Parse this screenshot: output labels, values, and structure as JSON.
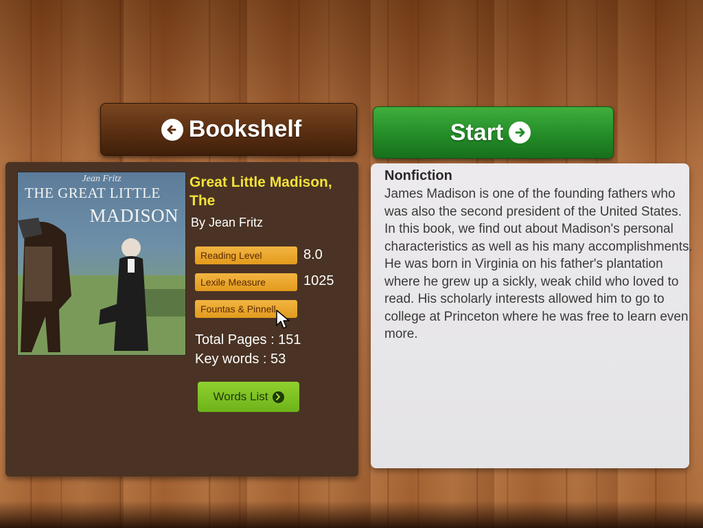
{
  "nav": {
    "bookshelf_label": "Bookshelf",
    "start_label": "Start"
  },
  "book": {
    "cover": {
      "author": "Jean Fritz",
      "title_line1": "THE GREAT LITTLE",
      "title_line2": "MADISON"
    },
    "title": "Great Little Madison, The",
    "author": "By Jean Fritz",
    "reading_level_label": "Reading Level",
    "reading_level_value": "8.0",
    "lexile_label": "Lexile Measure",
    "lexile_value": "1025",
    "fountas_label": "Fountas & Pinnell",
    "total_pages": "Total Pages : 151",
    "key_words": "Key words : 53",
    "words_list_label": "Words List"
  },
  "description": {
    "genre": "Nonfiction",
    "text": "James Madison is one of the founding fathers who was also the second president of the United States. In this book, we find out about Madison's personal characteristics as well as his many accomplishments. He was born in Virginia on his father's plantation where he grew up a sickly, weak child who loved to read. His scholarly interests allowed him to go to college at Princeton where he was free to learn even more."
  },
  "colors": {
    "bookshelf_button": "#5a2f12",
    "start_button": "#248c28",
    "title_yellow": "#f2e23a",
    "tag_orange": "#e39b1d",
    "words_list_green": "#7cc12a"
  },
  "icons": {
    "bookshelf": "arrow-left-circle-icon",
    "start": "arrow-right-circle-icon",
    "words_list": "arrow-right-circle-icon"
  }
}
